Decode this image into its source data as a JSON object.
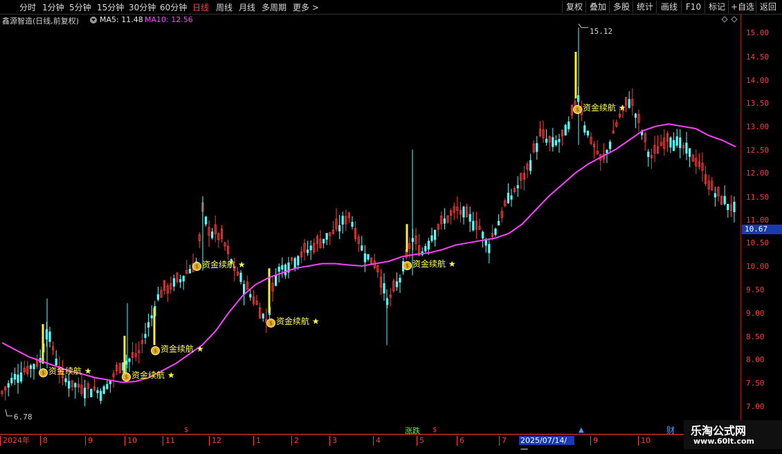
{
  "toolbar": {
    "periods": [
      "分时",
      "1分钟",
      "5分钟",
      "15分钟",
      "30分钟",
      "60分钟",
      "日线",
      "周线",
      "月线",
      "多周期",
      "更多 >"
    ],
    "active_period": "日线",
    "right_buttons": [
      "复权",
      "叠加",
      "多股",
      "统计",
      "画线",
      "F10",
      "标记",
      "+自选",
      "返回"
    ]
  },
  "info": {
    "stock": "鑫源智造(日线,前复权)",
    "ma5": "MA5: 11.48",
    "ma10": "MA10: 12.56"
  },
  "price_axis": [
    "15.00",
    "14.50",
    "14.00",
    "13.50",
    "13.00",
    "12.50",
    "12.00",
    "11.50",
    "11.00",
    "10.50",
    "10.00",
    "9.50",
    "9.00",
    "8.50",
    "8.00",
    "7.50",
    "7.00"
  ],
  "current_price": "10.67",
  "high_label": "15.12",
  "low_label": "6.78",
  "annotation_text": "资金续航",
  "date_axis": [
    "2024年",
    "8",
    "9",
    "10",
    "11",
    "12",
    "1",
    "2",
    "3",
    "4",
    "5",
    "6",
    "7",
    "2025/07/14/一",
    "9",
    "10"
  ],
  "markers": {
    "s": "$",
    "zd": "涨跌",
    "fin": "财"
  },
  "watermark": {
    "title": "乐淘公式网",
    "url": "www.60lt.com"
  },
  "colors": {
    "up": "#ff3a3a",
    "down": "#54ffff",
    "ma10": "#ff40ff",
    "ma5": "#ffffff",
    "signal": "#ffee33"
  },
  "chart_data": {
    "type": "candlestick",
    "ylim": [
      6.6,
      15.3
    ],
    "ma10": [
      8.35,
      8.2,
      8.05,
      7.95,
      7.85,
      7.75,
      7.68,
      7.6,
      7.55,
      7.5,
      7.52,
      7.6,
      7.75,
      7.9,
      8.1,
      8.3,
      8.6,
      9.0,
      9.35,
      9.6,
      9.75,
      9.85,
      9.95,
      10.0,
      10.05,
      10.05,
      10.02,
      10.0,
      10.05,
      10.1,
      10.2,
      10.25,
      10.28,
      10.35,
      10.45,
      10.5,
      10.55,
      10.6,
      10.7,
      10.9,
      11.2,
      11.5,
      11.75,
      12.0,
      12.2,
      12.35,
      12.5,
      12.7,
      12.9,
      13.0,
      13.05,
      13.0,
      12.95,
      12.8,
      12.7,
      12.56
    ]
  }
}
